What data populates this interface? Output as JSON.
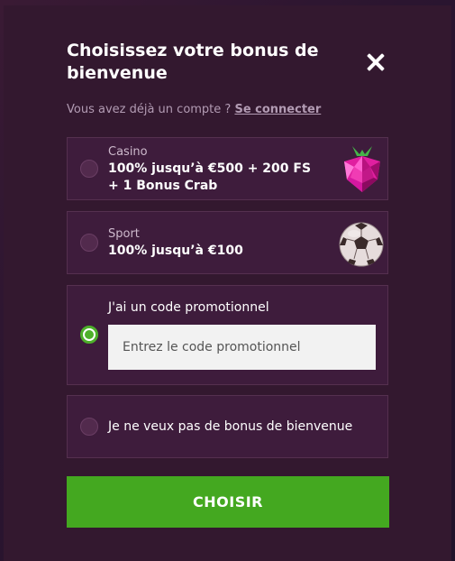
{
  "modal": {
    "title": "Choisissez votre bonus de bienvenue",
    "close_label": "close"
  },
  "login": {
    "prompt": "Vous avez déjà un compte ?",
    "link": "Se connecter"
  },
  "options": [
    {
      "kicker": "Casino",
      "text_line1": "100% jusqu’à €500 + 200 FS",
      "text_line2": "+ 1 Bonus Crab",
      "icon": "raspberry-icon",
      "selected": false
    },
    {
      "kicker": "Sport",
      "text_line1": "100% jusqu’à €100",
      "icon": "soccer-ball-icon",
      "selected": false
    },
    {
      "label": "J'ai un code promotionnel",
      "input_placeholder": "Entrez le code promotionnel",
      "input_value": "",
      "selected": true
    },
    {
      "label": "Je ne veux pas de bonus de bienvenue",
      "selected": false
    }
  ],
  "cta": {
    "label": "CHOISIR"
  },
  "colors": {
    "modal_bg": "#33182f",
    "option_bg": "#3e1c3c",
    "accent_green": "#44a820",
    "text": "#ffffff",
    "muted": "#b29bb3"
  }
}
